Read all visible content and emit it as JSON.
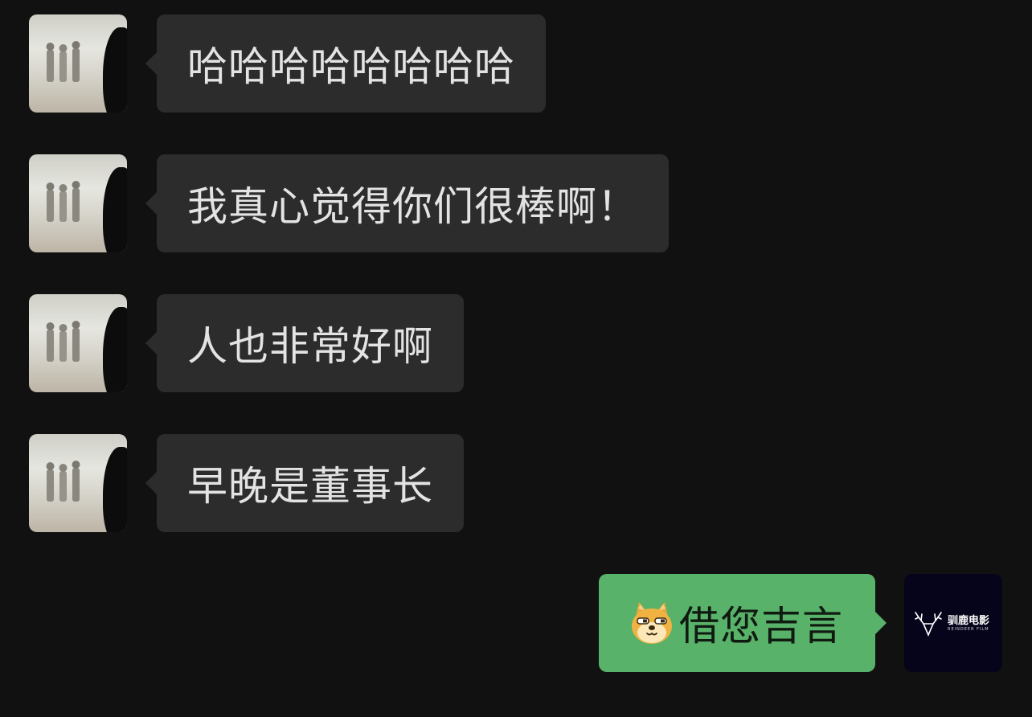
{
  "messages": [
    {
      "side": "incoming",
      "text": "哈哈哈哈哈哈哈哈",
      "avatar": "contact-photo"
    },
    {
      "side": "incoming",
      "text": "我真心觉得你们很棒啊！",
      "avatar": "contact-photo"
    },
    {
      "side": "incoming",
      "text": "人也非常好啊",
      "avatar": "contact-photo"
    },
    {
      "side": "incoming",
      "text": "早晚是董事长",
      "avatar": "contact-photo"
    },
    {
      "side": "outgoing",
      "emoji": "doge-emoji",
      "text": "借您吉言",
      "avatar": "reindeer-film-logo"
    }
  ],
  "self_avatar": {
    "name_cn": "驯鹿电影",
    "name_en": "REINDEER FILM"
  },
  "colors": {
    "background": "#111111",
    "incoming_bubble": "#2c2c2c",
    "outgoing_bubble": "#59b26a"
  }
}
